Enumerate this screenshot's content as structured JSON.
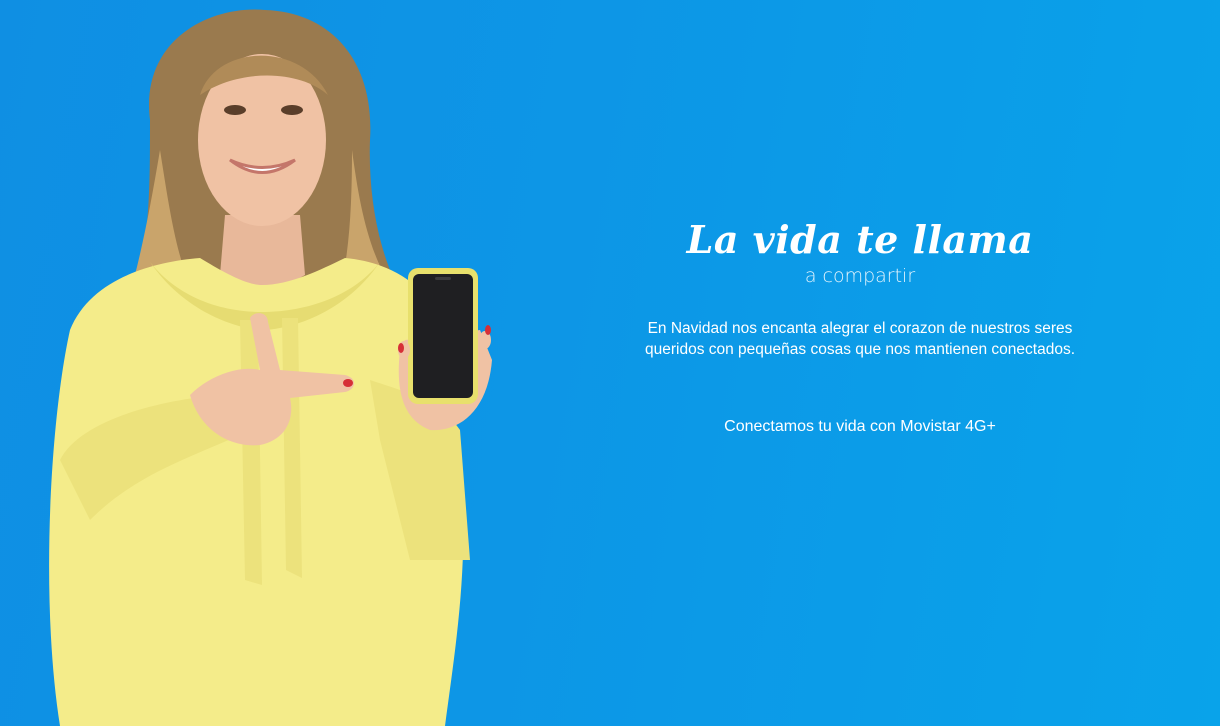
{
  "hero": {
    "headline": "La vida te llama",
    "subheadline": "a compartir",
    "body": "En Navidad nos encanta alegrar el corazon de nuestros seres queridos con pequeñas cosas que nos mantienen conectados.",
    "cta": "Conectamos tu vida con Movistar 4G+"
  },
  "colors": {
    "background": "#0d96e6",
    "hoodie": "#f4ec8a",
    "text": "#ffffff"
  }
}
